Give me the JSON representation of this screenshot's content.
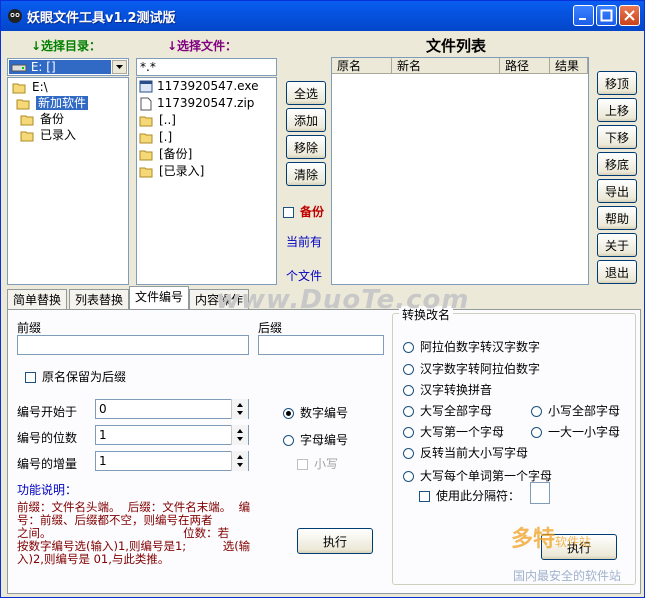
{
  "window": {
    "title": "妖眼文件工具v1.2测试版"
  },
  "left": {
    "select_dir_label": "↓选择目录：",
    "select_file_label": "↓选择文件：",
    "drive": "E: []",
    "tree": [
      "E:\\",
      "新加软件",
      "备份",
      "已录入"
    ],
    "filter": "*.*",
    "files": [
      "1173920547.exe",
      "1173920547.zip",
      "[..]",
      "[.]",
      "[备份]",
      "[已录入]"
    ]
  },
  "middle": {
    "buttons": [
      "全选",
      "添加",
      "移除",
      "清除"
    ],
    "backup_label": "备份",
    "current_label": "当前有",
    "count_label": "个文件"
  },
  "filelist": {
    "title": "文件列表",
    "columns": [
      "原名",
      "新名",
      "路径",
      "结果"
    ]
  },
  "right_buttons": [
    "移顶",
    "上移",
    "下移",
    "移底",
    "导出",
    "帮助",
    "关于",
    "退出"
  ],
  "tabs": [
    "简单替换",
    "列表替换",
    "文件编号",
    "内容操作"
  ],
  "numbering": {
    "prefix_label": "前缀",
    "suffix_label": "后缀",
    "keep_name_label": "原名保留为后缀",
    "start_label": "编号开始于",
    "start_value": "0",
    "digits_label": "编号的位数",
    "digits_value": "1",
    "increment_label": "编号的增量",
    "increment_value": "1",
    "numeric_label": "数字编号",
    "alpha_label": "字母编号",
    "lowercase_label": "小写",
    "func_label": "功能说明：",
    "desc_lines": [
      "前缀：文件名头端。  后缀：文件名末端。  编",
      "号：前缀、后缀都不空，则编号在两者",
      "之间。                                    位数：若",
      "按数字编号选(输入)1,则编号是1;          选(输",
      "入)2,则编号是 01,与此类推。"
    ],
    "execute_label": "执行"
  },
  "rename": {
    "group_label": "转换改名",
    "options": [
      "阿拉伯数字转汉字数字",
      "汉字数字转阿拉伯数字",
      "汉字转换拼音",
      "大写全部字母",
      "小写全部字母",
      "大写第一个字母",
      "一大一小字母",
      "反转当前大小写字母",
      "大写每个单词第一个字母"
    ],
    "separator_label": "使用此分隔符：",
    "execute_label": "执行"
  },
  "watermark": {
    "site": "www.DuoTe.com",
    "brand": "多特",
    "brand2": "软件站",
    "slogan": "国内最安全的软件站"
  }
}
